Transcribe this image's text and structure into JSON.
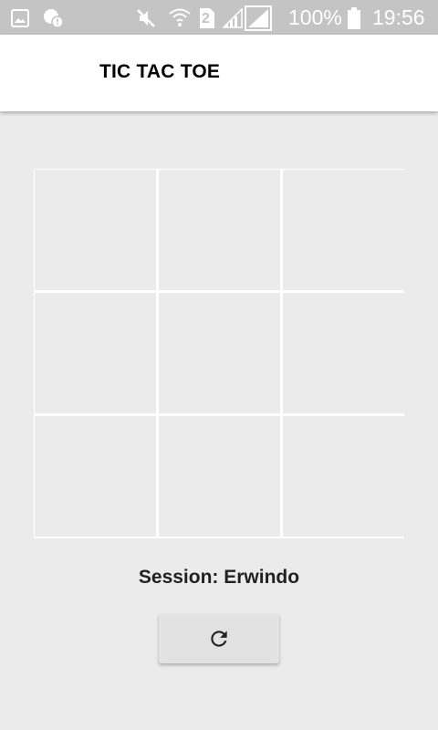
{
  "status_bar": {
    "battery_percent": "100%",
    "time": "19:56",
    "sim_badge": "2",
    "icons": [
      "image-icon",
      "chat-alert-icon",
      "mute-icon",
      "wifi-icon",
      "sim-2-icon",
      "signal-1-icon",
      "signal-2-icon",
      "battery-icon"
    ]
  },
  "app_bar": {
    "title": "TIC TAC TOE"
  },
  "board": {
    "cells": [
      "",
      "",
      "",
      "",
      "",
      "",
      "",
      "",
      ""
    ]
  },
  "session": {
    "label": "Session: Erwindo"
  },
  "reset_button": {
    "icon": "refresh-icon"
  },
  "colors": {
    "status_bar_bg": "#c4c4c4",
    "app_bar_bg": "#ffffff",
    "page_bg": "#ebebeb",
    "grid_line": "#ffffff",
    "button_bg": "#e2e2e2"
  }
}
